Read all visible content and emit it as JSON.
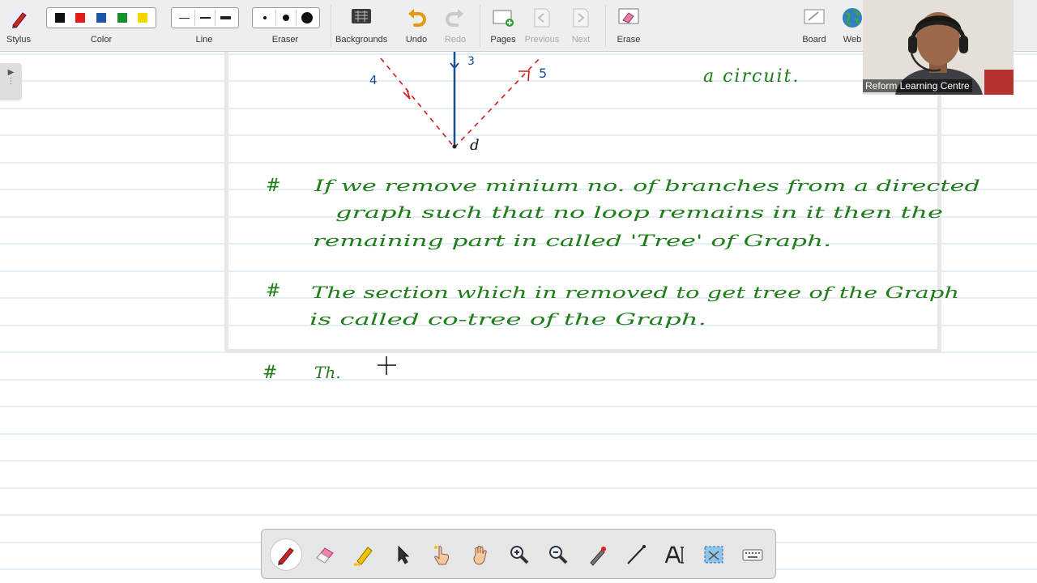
{
  "toolbar": {
    "stylus": "Stylus",
    "color": "Color",
    "line": "Line",
    "eraser": "Eraser",
    "backgrounds": "Backgrounds",
    "undo": "Undo",
    "redo": "Redo",
    "pages": "Pages",
    "previous": "Previous",
    "next": "Next",
    "erase": "Erase",
    "board": "Board",
    "web": "Web",
    "colors": [
      "#111111",
      "#e31b1b",
      "#1b58a8",
      "#17912a",
      "#f3d800"
    ]
  },
  "webcam": {
    "name": "Reform Learning Centre"
  },
  "notes": {
    "diagram_labels": {
      "node_d": "d",
      "branch3": "3",
      "branch4": "4",
      "branch5": "5"
    },
    "top_right_text": "a circuit.",
    "para1": {
      "bullet": "#",
      "line1": "If we remove minium no. of branches from a directed",
      "line2": "graph such that no loop remains in it then the",
      "line3": "remaining part in called 'Tree' of Graph."
    },
    "para2": {
      "bullet": "#",
      "line1": "The section which in removed to get tree of the Graph",
      "line2": "is called co-tree of the Graph."
    },
    "para3": {
      "bullet": "#",
      "line1": "Th."
    },
    "ink_colors": {
      "green": "#1f7d1a",
      "red": "#d21a1a",
      "blue": "#1b4f8e"
    }
  },
  "bottom_tools": [
    "pen-tool",
    "highlighter-eraser",
    "highlighter",
    "select-arrow",
    "touch-hand",
    "pan-hand",
    "zoom-in",
    "zoom-out",
    "laser-pen",
    "line-tool",
    "text-tool",
    "screen-capture",
    "keyboard"
  ]
}
